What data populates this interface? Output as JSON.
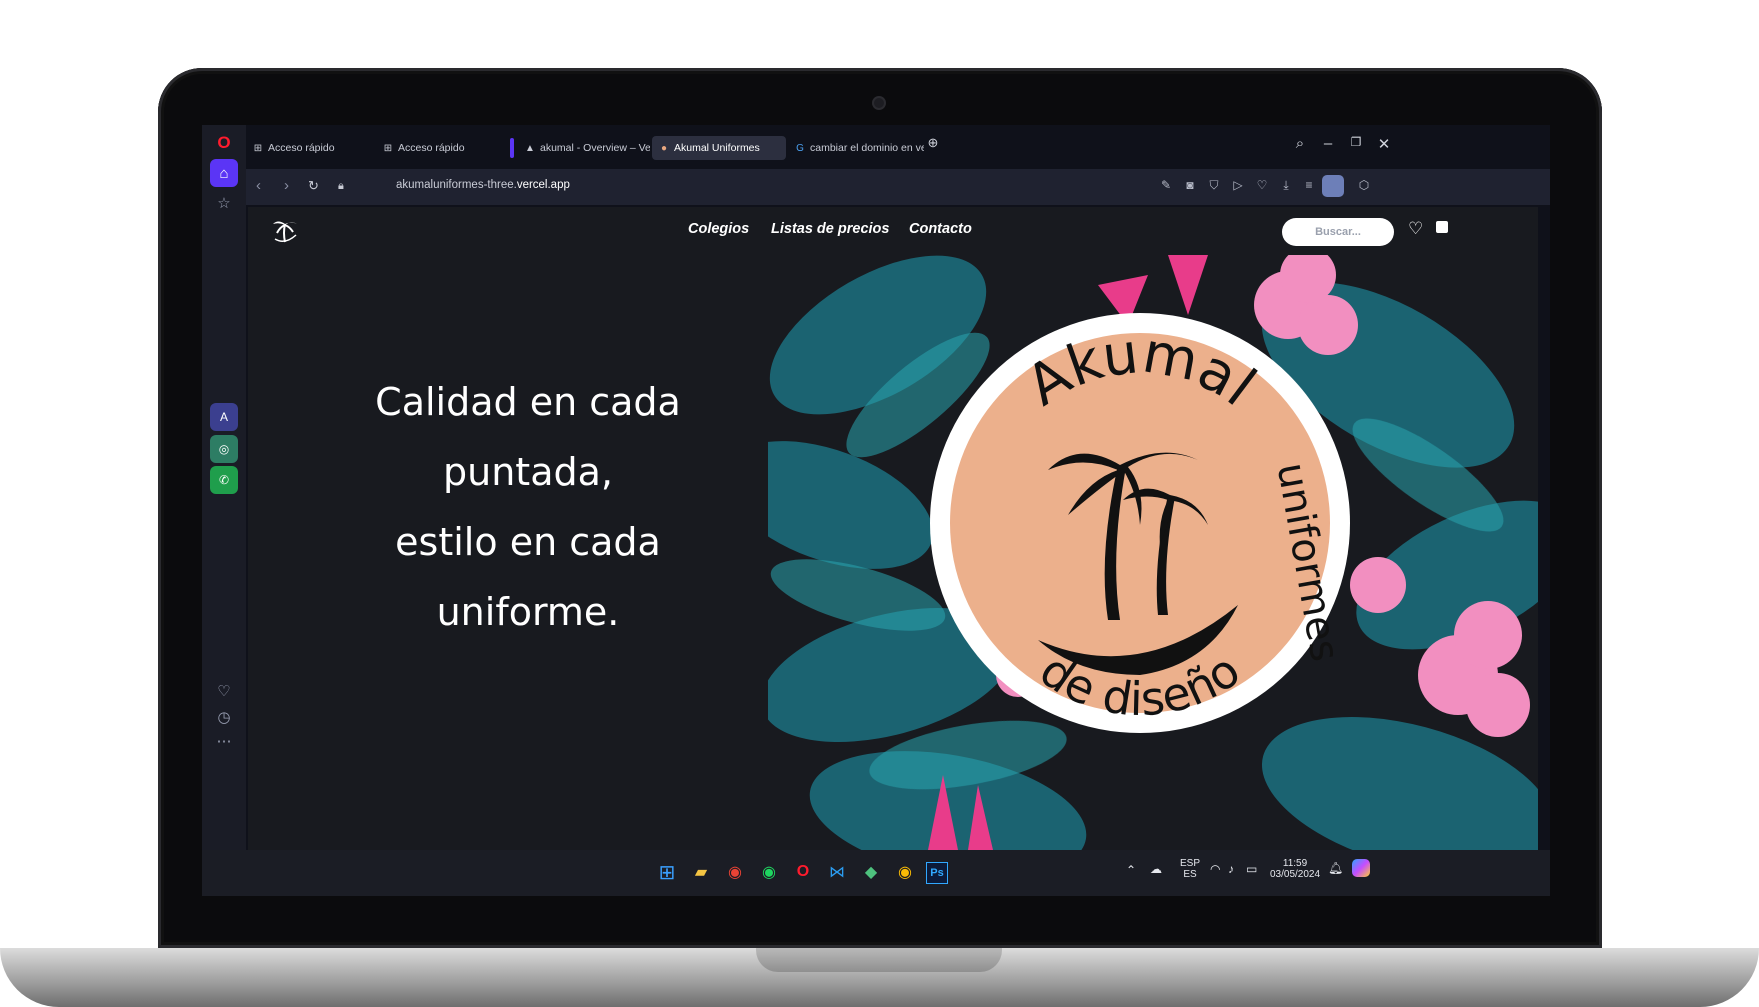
{
  "tabs": [
    {
      "label": "Acceso rápido",
      "icon": "grid-icon"
    },
    {
      "label": "Acceso rápido",
      "icon": "grid-icon"
    },
    {
      "label": "akumal - Overview – Vercel",
      "icon": "vercel-icon"
    },
    {
      "label": "Akumal Uniformes",
      "icon": "site-icon",
      "active": true
    },
    {
      "label": "cambiar el dominio en vercel",
      "icon": "google-icon"
    }
  ],
  "address_bar": {
    "url_prefix": "akumaluniformes-three.",
    "url_domain": "vercel.app"
  },
  "site": {
    "nav": [
      "Colegios",
      "Listas de precios",
      "Contacto"
    ],
    "search_placeholder": "Buscar...",
    "hero_lines": [
      "Calidad en cada",
      "puntada,",
      "estilo en cada",
      "uniforme."
    ],
    "logo_text_top": "Akumal",
    "logo_text_right": "uniformes",
    "logo_text_bottom": "de diseño",
    "colors": {
      "page_bg": "#181a1f",
      "badge_fill": "#ecb08c",
      "badge_ring": "#ffffff",
      "leaf": "#1f6f7a",
      "flower": "#f28fc0"
    }
  },
  "taskbar": {
    "language": "ESP",
    "language_sub": "ES",
    "time": "11:59",
    "date": "03/05/2024"
  }
}
